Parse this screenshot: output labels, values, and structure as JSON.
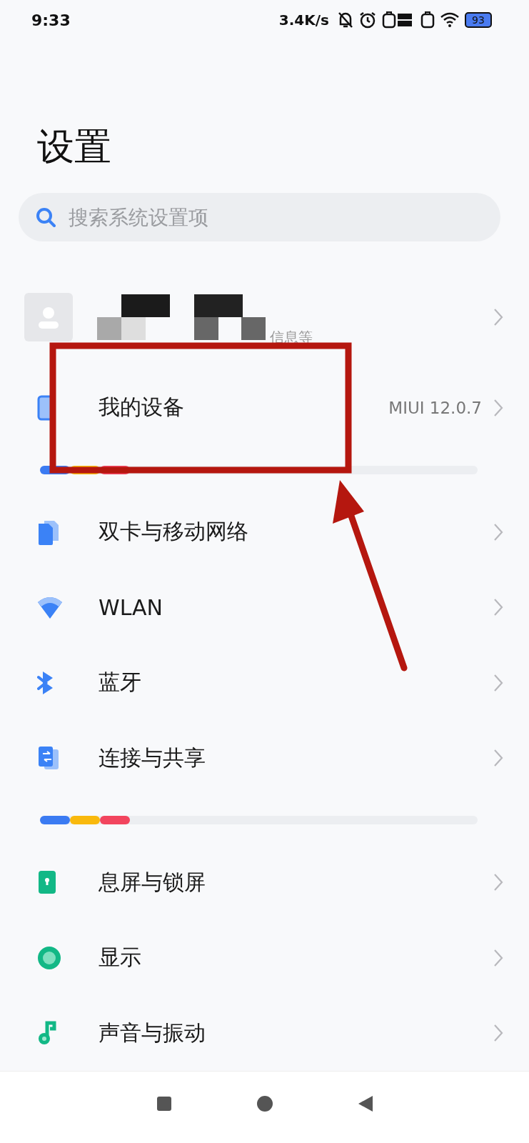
{
  "status_bar": {
    "time": "9:33",
    "speed": "3.4K/s",
    "battery": "93"
  },
  "title": "设置",
  "search": {
    "placeholder": "搜索系统设置项"
  },
  "account": {
    "subtitle": "信息等"
  },
  "sections": [
    [
      {
        "kind": "device",
        "label": "我的设备",
        "value": "MIUI 12.0.7"
      }
    ],
    [
      {
        "kind": "sim",
        "label": "双卡与移动网络"
      },
      {
        "kind": "wifi",
        "label": "WLAN"
      },
      {
        "kind": "bluetooth",
        "label": "蓝牙"
      },
      {
        "kind": "share",
        "label": "连接与共享"
      }
    ],
    [
      {
        "kind": "lock",
        "label": "息屏与锁屏"
      },
      {
        "kind": "display",
        "label": "显示"
      },
      {
        "kind": "sound",
        "label": "声音与振动"
      }
    ]
  ]
}
